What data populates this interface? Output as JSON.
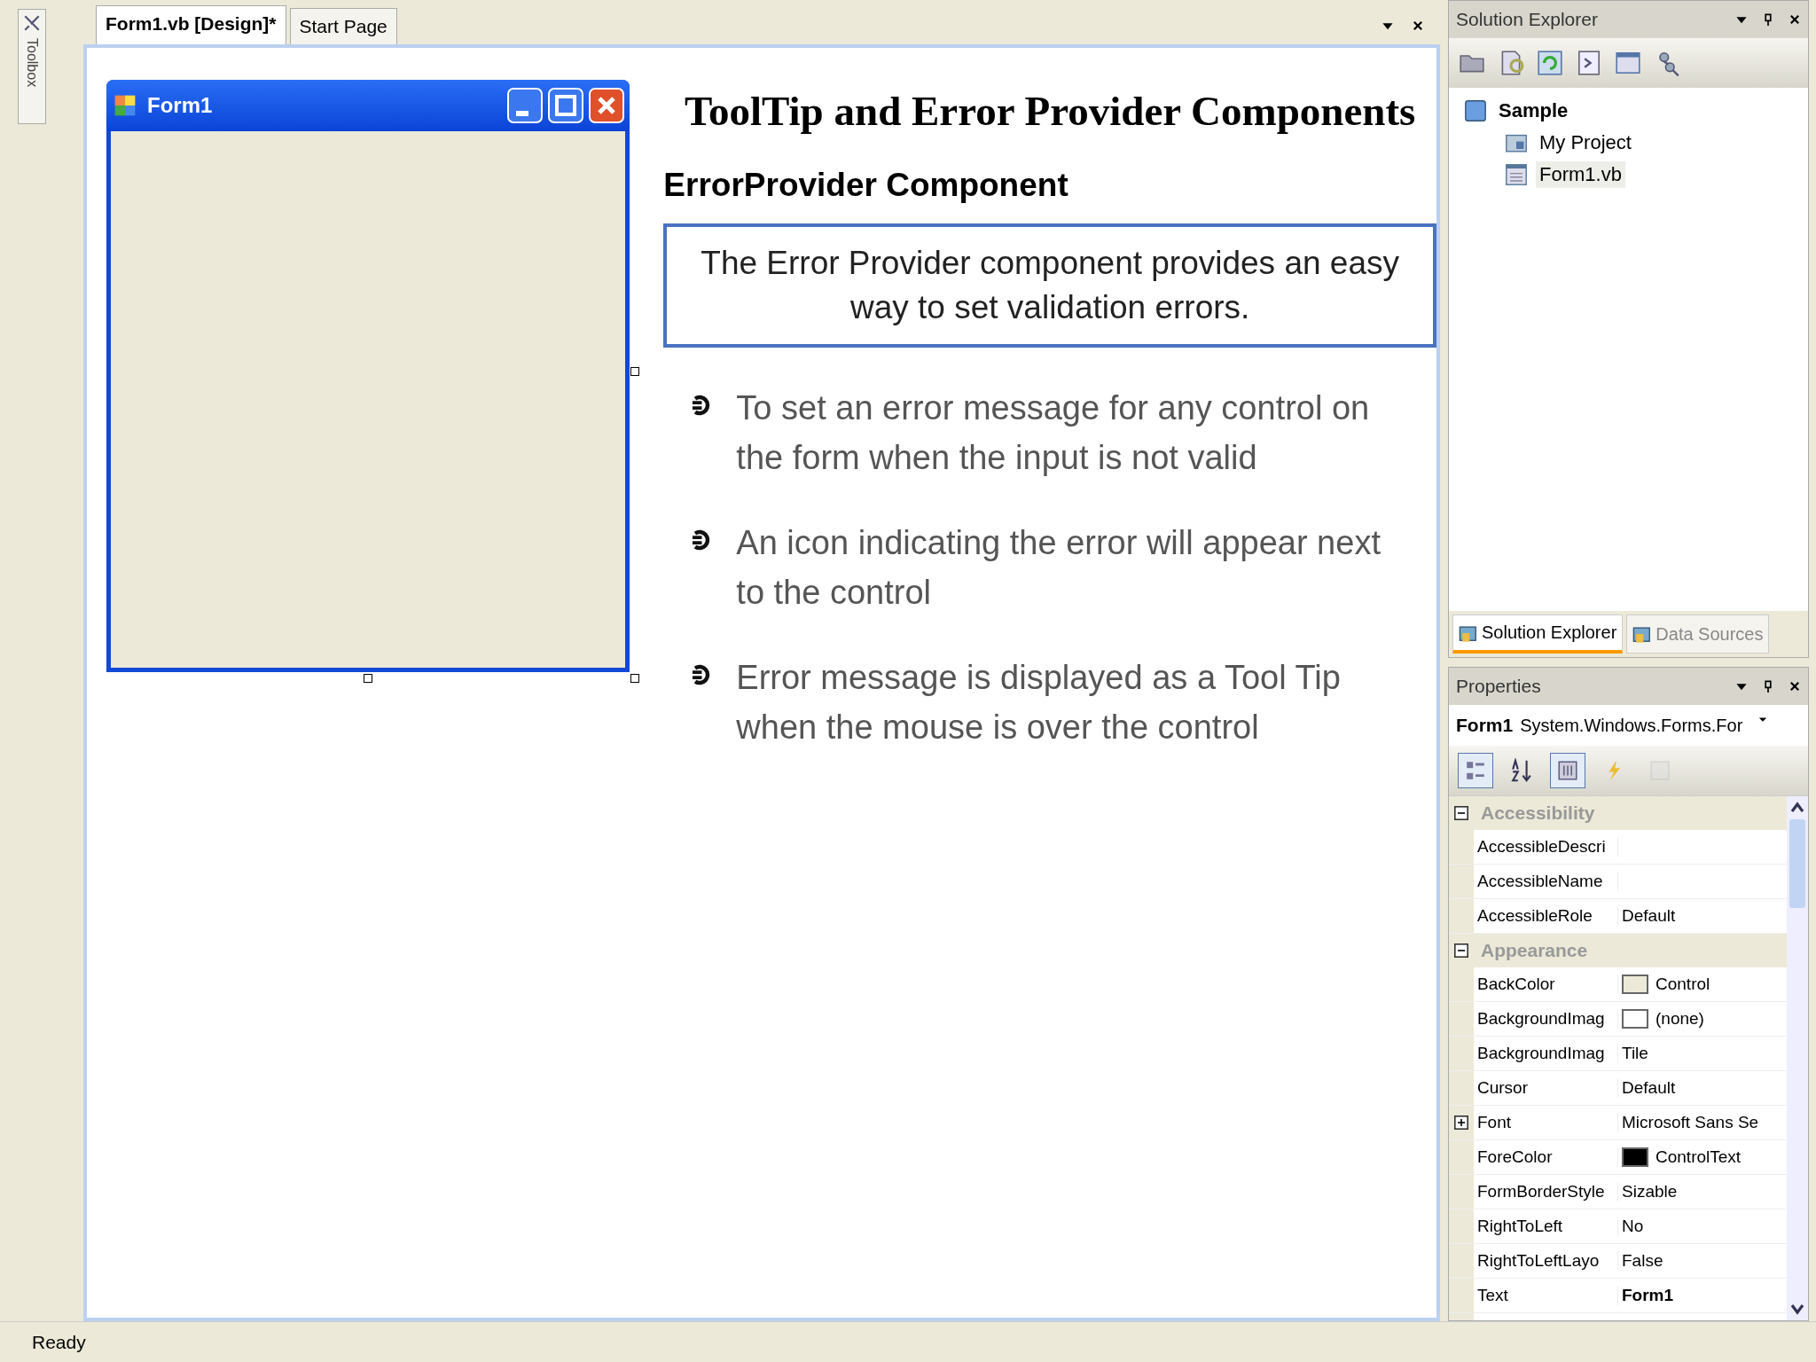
{
  "toolbox": {
    "label": "Toolbox"
  },
  "document_tabs": [
    {
      "label": "Form1.vb [Design]*",
      "selected": true
    },
    {
      "label": "Start Page",
      "selected": false
    }
  ],
  "designer": {
    "form": {
      "title": "Form1"
    }
  },
  "slide": {
    "title": "ToolTip and Error Provider Components",
    "subtitle": "ErrorProvider Component",
    "callout": "The Error Provider component provides an easy way to set validation errors.",
    "bullets": [
      "To set an error message for any control on the form when the input is not valid",
      "An icon indicating the error will appear next to the control",
      "Error message is displayed as a Tool Tip when the mouse is over the control"
    ]
  },
  "solution_explorer": {
    "title": "Solution Explorer",
    "tree": [
      {
        "label": "Sample",
        "kind": "solution",
        "selected": false,
        "children": [
          {
            "label": "My Project",
            "kind": "project",
            "selected": false
          },
          {
            "label": "Form1.vb",
            "kind": "form",
            "selected": true
          }
        ]
      }
    ],
    "tabs": [
      {
        "label": "Solution Explorer",
        "selected": true
      },
      {
        "label": "Data Sources",
        "selected": false
      }
    ]
  },
  "properties": {
    "title": "Properties",
    "object_name": "Form1",
    "object_type": "System.Windows.Forms.For",
    "toolbar": [
      {
        "kind": "categorized",
        "selected": true,
        "disabled": false
      },
      {
        "kind": "alphabetical",
        "selected": false,
        "disabled": false
      },
      {
        "kind": "properties",
        "selected": true,
        "disabled": false
      },
      {
        "kind": "events",
        "selected": false,
        "disabled": false
      },
      {
        "kind": "pages",
        "selected": false,
        "disabled": true
      }
    ],
    "categories": [
      {
        "name": "Accessibility",
        "expanded": true,
        "rows": [
          {
            "name": "AccessibleDescri",
            "value": ""
          },
          {
            "name": "AccessibleName",
            "value": ""
          },
          {
            "name": "AccessibleRole",
            "value": "Default",
            "modified": false
          }
        ]
      },
      {
        "name": "Appearance",
        "expanded": true,
        "rows": [
          {
            "name": "BackColor",
            "value": "Control",
            "color": "#ece9d8",
            "modified": false
          },
          {
            "name": "BackgroundImag",
            "value": "(none)",
            "color": "#ffffff",
            "modified": false
          },
          {
            "name": "BackgroundImag",
            "value": "Tile",
            "modified": false
          },
          {
            "name": "Cursor",
            "value": "Default",
            "modified": false
          },
          {
            "name": "Font",
            "value": "Microsoft Sans Se",
            "expandable": true,
            "modified": false
          },
          {
            "name": "ForeColor",
            "value": "ControlText",
            "color": "#000000",
            "modified": false
          },
          {
            "name": "FormBorderStyle",
            "value": "Sizable",
            "modified": false
          },
          {
            "name": "RightToLeft",
            "value": "No",
            "modified": false
          },
          {
            "name": "RightToLeftLayo",
            "value": "False",
            "modified": false
          },
          {
            "name": "Text",
            "value": "Form1",
            "modified": true
          }
        ]
      }
    ]
  },
  "status_bar": {
    "text": "Ready"
  }
}
